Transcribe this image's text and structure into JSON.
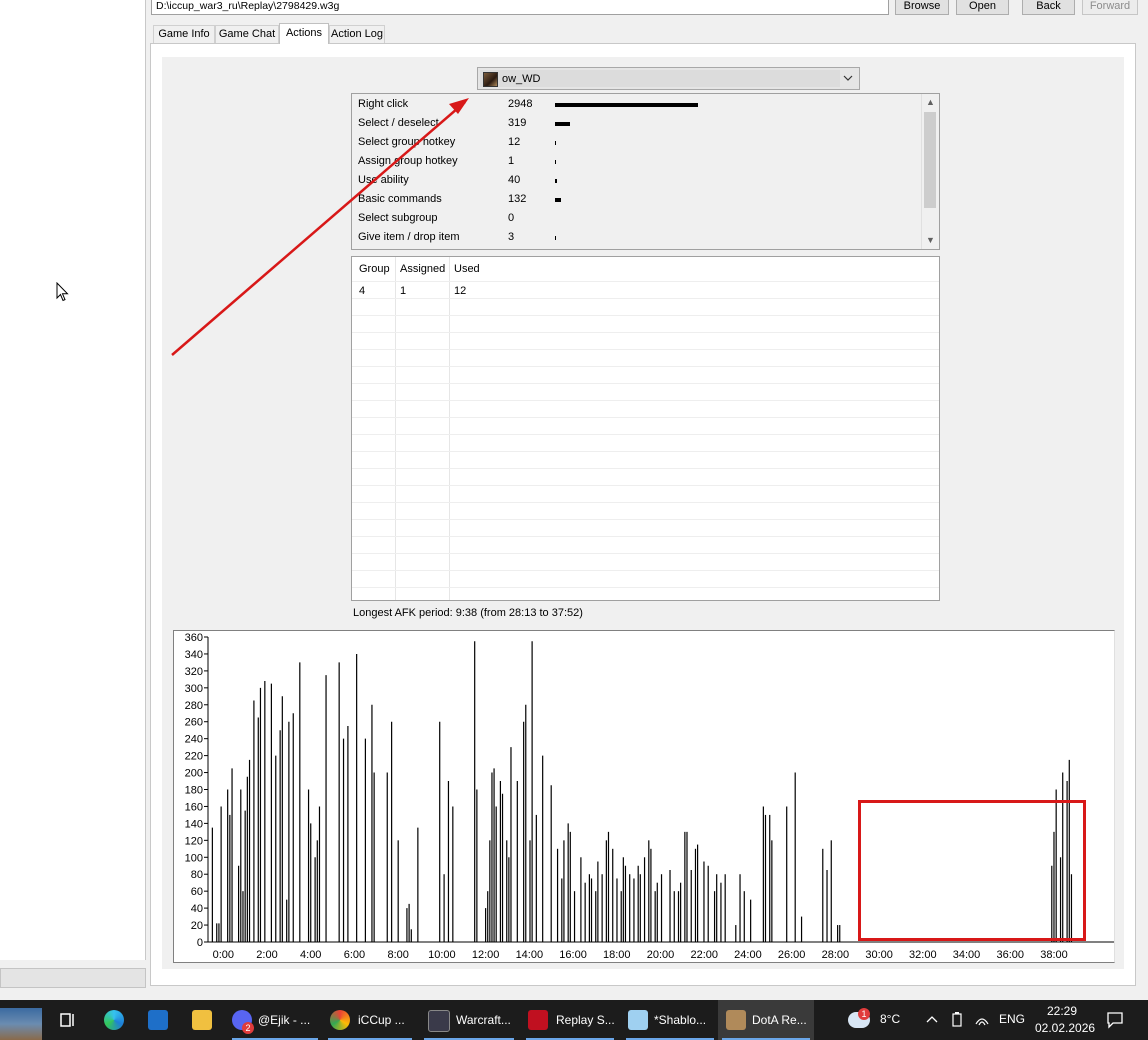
{
  "file": {
    "path": "D:\\iccup_war3_ru\\Replay\\2798429.w3g",
    "browse_label": "Browse",
    "open_label": "Open",
    "back_label": "Back",
    "forward_label": "Forward"
  },
  "tabs": [
    {
      "label": "Game Info",
      "active": false
    },
    {
      "label": "Game Chat",
      "active": false
    },
    {
      "label": "Actions",
      "active": true
    },
    {
      "label": "Action Log",
      "active": false
    }
  ],
  "player": {
    "selected": "ow_WD"
  },
  "actions": [
    {
      "name": "Right click",
      "count": "2948",
      "value": 2948
    },
    {
      "name": "Select / deselect",
      "count": "319",
      "value": 319
    },
    {
      "name": "Select group hotkey",
      "count": "12",
      "value": 12
    },
    {
      "name": "Assign group hotkey",
      "count": "1",
      "value": 1
    },
    {
      "name": "Use ability",
      "count": "40",
      "value": 40
    },
    {
      "name": "Basic commands",
      "count": "132",
      "value": 132
    },
    {
      "name": "Select subgroup",
      "count": "0",
      "value": 0
    },
    {
      "name": "Give item / drop item",
      "count": "3",
      "value": 3
    }
  ],
  "groups": {
    "headers": [
      "Group",
      "Assigned",
      "Used"
    ],
    "rows": [
      [
        "4",
        "1",
        "12"
      ]
    ]
  },
  "afk": {
    "text": "Longest AFK period: 9:38 (from 28:13 to 37:52)"
  },
  "chart_data": {
    "type": "bar",
    "ylim": [
      0,
      360
    ],
    "yticks": [
      0,
      20,
      40,
      60,
      80,
      100,
      120,
      140,
      160,
      180,
      200,
      220,
      240,
      260,
      280,
      300,
      320,
      340,
      360
    ],
    "xtick_labels": [
      "0:00",
      "2:00",
      "4:00",
      "6:00",
      "8:00",
      "10:00",
      "12:00",
      "14:00",
      "16:00",
      "18:00",
      "20:00",
      "22:00",
      "24:00",
      "26:00",
      "28:00",
      "30:00",
      "32:00",
      "34:00",
      "36:00",
      "38:00"
    ],
    "x_minutes_range": [
      -0.7,
      40.7
    ],
    "bin_minutes": 0.1,
    "values": [
      135,
      0,
      22,
      22,
      160,
      0,
      0,
      180,
      150,
      205,
      0,
      0,
      90,
      180,
      60,
      155,
      195,
      215,
      0,
      285,
      0,
      265,
      300,
      0,
      308,
      0,
      0,
      305,
      0,
      220,
      0,
      250,
      290,
      0,
      50,
      260,
      0,
      270,
      0,
      0,
      330,
      0,
      0,
      0,
      180,
      140,
      0,
      100,
      120,
      160,
      0,
      0,
      315,
      0,
      0,
      0,
      0,
      0,
      330,
      0,
      240,
      0,
      255,
      0,
      0,
      0,
      340,
      0,
      0,
      0,
      240,
      0,
      0,
      280,
      200,
      0,
      0,
      0,
      0,
      0,
      200,
      0,
      260,
      0,
      0,
      120,
      0,
      0,
      0,
      40,
      45,
      15,
      0,
      0,
      135,
      0,
      0,
      0,
      0,
      0,
      0,
      0,
      0,
      0,
      260,
      0,
      80,
      0,
      190,
      0,
      160,
      0,
      0,
      0,
      0,
      0,
      0,
      0,
      0,
      0,
      355,
      180,
      0,
      0,
      0,
      0,
      0,
      0,
      0,
      0,
      0,
      0,
      0,
      0,
      0,
      0,
      0,
      0,
      0,
      0,
      0,
      0,
      0,
      0,
      0,
      0,
      0,
      0,
      0,
      0,
      0,
      0,
      0,
      0,
      0,
      0,
      0,
      0,
      0,
      0,
      0,
      0,
      0,
      0,
      0,
      0,
      0,
      0,
      0,
      0,
      0,
      0,
      0,
      0,
      0,
      0,
      0,
      0,
      0,
      0,
      0,
      0,
      0,
      0,
      0,
      0,
      0,
      0,
      0,
      0,
      0,
      0,
      0,
      0,
      0,
      0,
      0,
      0,
      0,
      0,
      0,
      0,
      0,
      0,
      0,
      0,
      0,
      0,
      0,
      0,
      0,
      0,
      0,
      0,
      0,
      0,
      0,
      0,
      0,
      0,
      0,
      0,
      0,
      0,
      0,
      0,
      0,
      0,
      0,
      0,
      0,
      0,
      0,
      0,
      0,
      0,
      0,
      0,
      0,
      0,
      0,
      0,
      0,
      0,
      0,
      0,
      0,
      0,
      0,
      0,
      0,
      0,
      0,
      0,
      0,
      0,
      0,
      0,
      0,
      0,
      0,
      0,
      0,
      0,
      0,
      0,
      0,
      0,
      0,
      0,
      0,
      0,
      0,
      0,
      0,
      0,
      0,
      0,
      0,
      0,
      0,
      0,
      0,
      0,
      0,
      0,
      0,
      0,
      0,
      0,
      0,
      0,
      0,
      0,
      0,
      0,
      0,
      0,
      0,
      0,
      0,
      0,
      0,
      0,
      0,
      0,
      0,
      0,
      0,
      0,
      0,
      0,
      0,
      0,
      0,
      0,
      0,
      0,
      0,
      0,
      0,
      0,
      0,
      0,
      0,
      0,
      0,
      0,
      0,
      0,
      0,
      0,
      0,
      0,
      0,
      0,
      0,
      0,
      0,
      0,
      0,
      0,
      0,
      0,
      0,
      0,
      0,
      0,
      0,
      0,
      0,
      0,
      0,
      0,
      0,
      0,
      0,
      0,
      0,
      0,
      0,
      0,
      0,
      0,
      0,
      0,
      0,
      0,
      0,
      0,
      0,
      0,
      0,
      0,
      0,
      0,
      0,
      0,
      0,
      0,
      0,
      0,
      0,
      0,
      0,
      0,
      0,
      0,
      0,
      0,
      0,
      0,
      0,
      0,
      0,
      0,
      0,
      0,
      0,
      0,
      0,
      0,
      0,
      0,
      0,
      0,
      0,
      0,
      0,
      0,
      0,
      0,
      0,
      0,
      0,
      0,
      0,
      0,
      0,
      0,
      0,
      0,
      0,
      0,
      0,
      0,
      0,
      0,
      0,
      0,
      0,
      0,
      0,
      0,
      0,
      0,
      0,
      0,
      0,
      0,
      0,
      0,
      0,
      0,
      0,
      0,
      0,
      0,
      0,
      0,
      0,
      0,
      0,
      0,
      0,
      0,
      0,
      0,
      0,
      0,
      0,
      0,
      0,
      0,
      0,
      0,
      0
    ],
    "segments": [
      {
        "from": 12.0,
        "to": 14.9,
        "values": [
          40,
          60,
          120,
          200,
          205,
          160,
          0,
          190,
          175,
          0,
          120,
          100,
          230,
          0,
          0,
          190,
          0,
          0,
          260,
          280,
          0,
          120,
          355,
          0,
          150,
          0,
          0,
          220,
          0,
          0
        ]
      },
      {
        "from": 15.0,
        "to": 28.2,
        "values": [
          185,
          0,
          0,
          110,
          0,
          75,
          120,
          0,
          140,
          130,
          0,
          60,
          0,
          0,
          100,
          0,
          70,
          0,
          80,
          75,
          0,
          60,
          95,
          0,
          80,
          0,
          120,
          130,
          0,
          110,
          0,
          75,
          0,
          60,
          100,
          90,
          0,
          80,
          0,
          75,
          0,
          90,
          80,
          0,
          100,
          0,
          120,
          110,
          0,
          60,
          70,
          0,
          80,
          0,
          0,
          0,
          85,
          0,
          60,
          0,
          60,
          70,
          0,
          130,
          130,
          0,
          85,
          0,
          110,
          115,
          0,
          0,
          95,
          0,
          90,
          0,
          0,
          60,
          80,
          0,
          70,
          0,
          80,
          0,
          0,
          0,
          0,
          20,
          0,
          80,
          0,
          60,
          0,
          0,
          50,
          0,
          0,
          0,
          0,
          0,
          160,
          150,
          0,
          150,
          120,
          0,
          0,
          0,
          0,
          0,
          0,
          160,
          0,
          0,
          0,
          200,
          0,
          0,
          30,
          0,
          0,
          0,
          0,
          0,
          0,
          0,
          0,
          0,
          110,
          0,
          85,
          0,
          120,
          0,
          0,
          20
        ]
      },
      {
        "from": 28.2,
        "to": 37.8,
        "values": [
          20,
          0,
          0,
          0,
          0,
          0,
          0,
          0,
          0,
          0,
          0,
          0,
          0,
          0,
          0,
          0,
          0,
          0,
          0,
          0,
          0,
          0,
          0,
          0,
          0,
          0,
          0,
          0,
          0,
          0,
          0,
          0,
          0,
          0,
          0,
          0,
          0,
          0,
          0,
          0,
          0,
          0,
          0,
          0,
          0,
          0,
          0,
          0,
          0,
          0,
          0,
          0,
          0,
          0,
          0,
          0,
          0,
          0,
          0,
          0,
          0,
          0,
          0,
          0,
          0,
          0,
          0,
          0,
          0,
          0,
          0,
          0,
          0,
          0,
          0,
          0,
          0,
          0,
          0,
          0,
          0,
          0,
          0,
          0,
          0,
          0,
          0,
          0,
          0,
          0,
          0,
          0,
          0,
          0,
          0
        ]
      },
      {
        "from": 37.9,
        "to": 38.9,
        "values": [
          90,
          130,
          180,
          0,
          100,
          200,
          0,
          190,
          215,
          80
        ]
      }
    ]
  },
  "taskbar": {
    "items": [
      {
        "label": "@Ejik - ...",
        "badge": "2"
      },
      {
        "label": "iCCup ..."
      },
      {
        "label": "Warcraft..."
      },
      {
        "label": "Replay S..."
      },
      {
        "label": "*Shablo..."
      },
      {
        "label": "DotA Re...",
        "active": true
      }
    ],
    "weather_temp": "8°C",
    "weather_badge": "1",
    "lang": "ENG",
    "time": "22:29",
    "date": "02.02.2026"
  }
}
